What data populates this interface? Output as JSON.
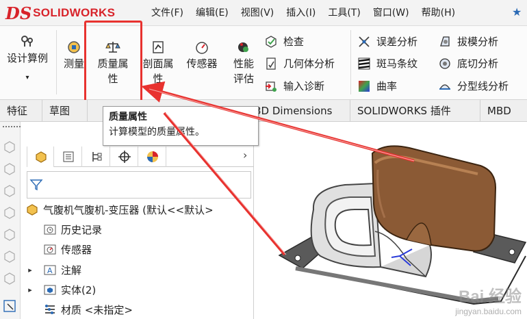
{
  "app": {
    "logo_ds": "DS",
    "logo_text": "SOLIDWORKS"
  },
  "menu": [
    "文件(F)",
    "编辑(E)",
    "视图(V)",
    "插入(I)",
    "工具(T)",
    "窗口(W)",
    "帮助(H)"
  ],
  "ribbon": {
    "design_study": "设计算例",
    "measure": "测量",
    "mass_properties_l1": "质量属",
    "mass_properties_l2": "性",
    "section_properties_l1": "剖面属",
    "section_properties_l2": "性",
    "sensor": "传感器",
    "performance_l1": "性能",
    "performance_l2": "评估",
    "check": "检查",
    "geometry_analysis": "几何体分析",
    "import_diagnostics": "输入诊断",
    "deviation_analysis": "误差分析",
    "zebra_stripes": "斑马条纹",
    "curvature": "曲率",
    "draft_analysis": "拔模分析",
    "undercut_analysis": "底切分析",
    "parting_line_analysis": "分型线分析"
  },
  "tabs": [
    "特征",
    "草图",
    "3D Dimensions",
    "SOLIDWORKS 插件",
    "MBD"
  ],
  "tooltip": {
    "title": "质量属性",
    "description": "计算模型的质量属性。"
  },
  "tree": {
    "root": "气腹机气腹机-变压器 (默认<<默认>",
    "items": [
      "历史记录",
      "传感器",
      "注解",
      "实体(2)",
      "材质 <未指定>"
    ]
  },
  "watermark": {
    "main": "Bai 经验",
    "sub": "jingyan.baidu.com"
  },
  "colors": {
    "accent_red": "#e8322f",
    "brand_red": "#d8232a",
    "model_copper": "#8b5a35",
    "link_blue": "#2a6ab5"
  }
}
